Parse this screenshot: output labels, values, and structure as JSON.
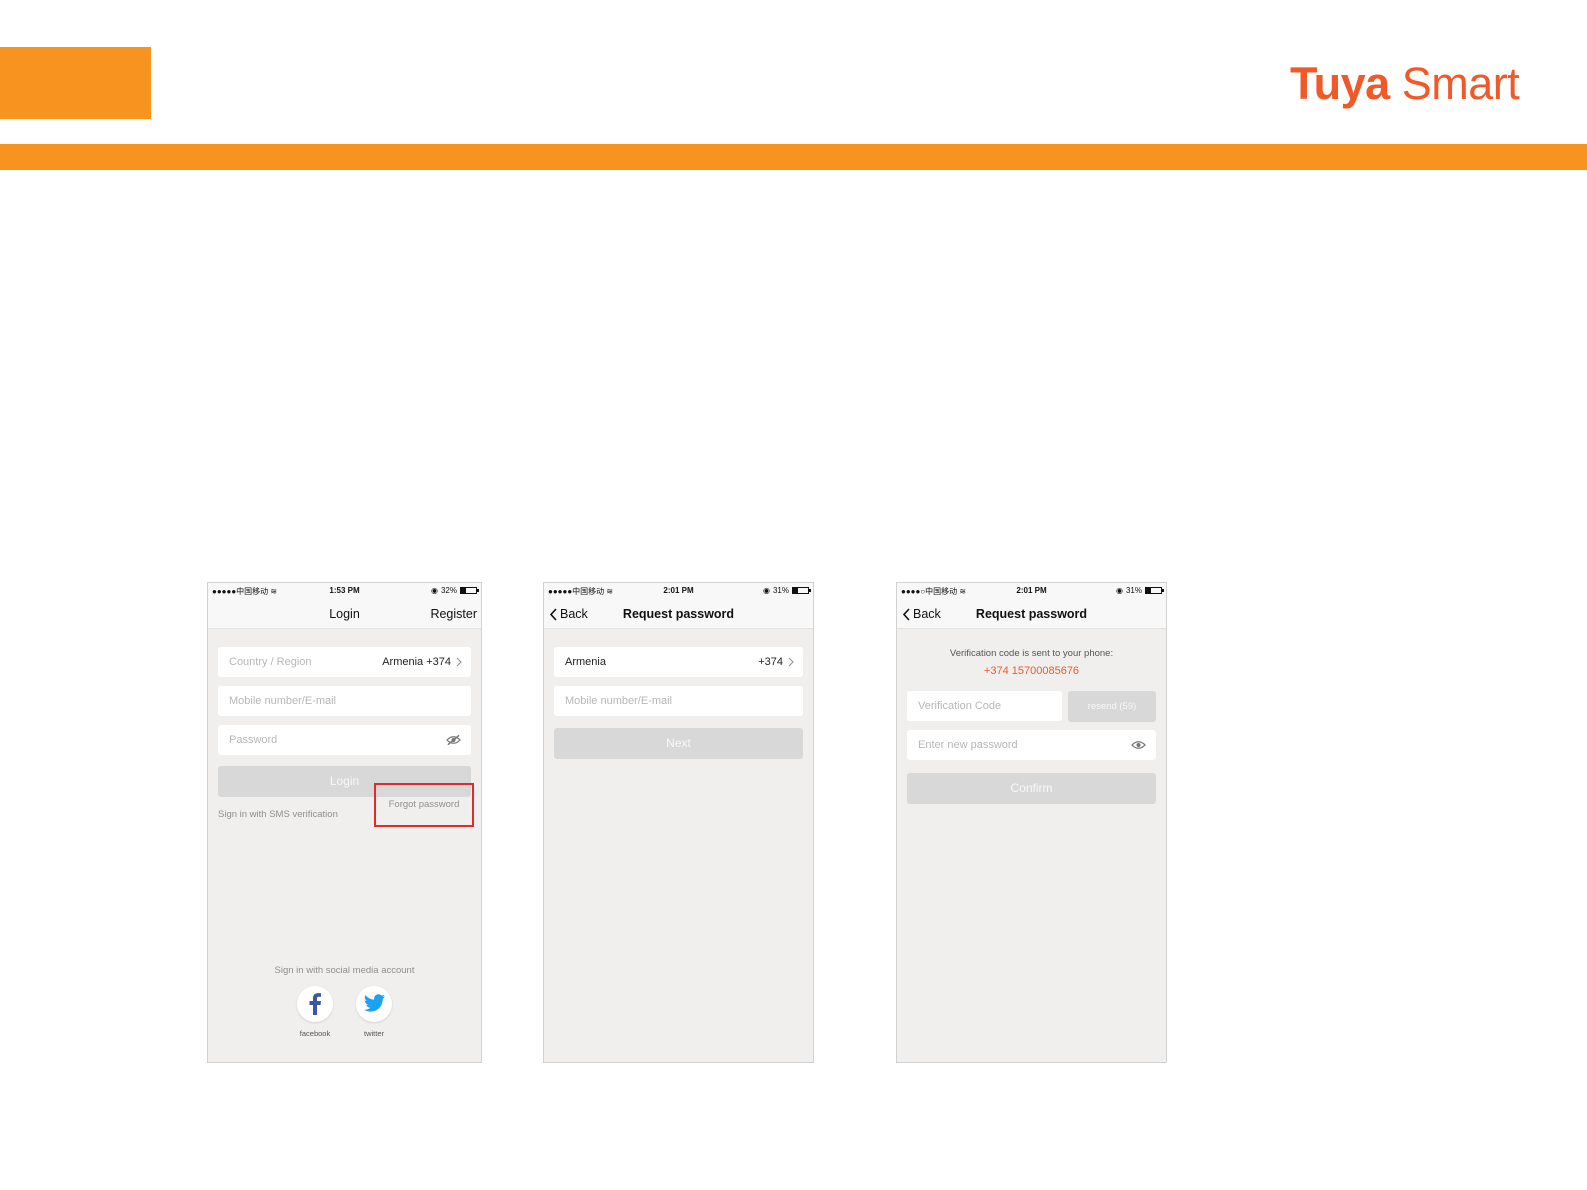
{
  "slide": {
    "logo": {
      "brand_part1": "Tuya",
      "brand_part2": " Smart"
    },
    "colors": {
      "accent_orange": "#f7931e",
      "logo_orange": "#f05a28",
      "highlight_red": "#e02b2b"
    }
  },
  "screen_login": {
    "status": {
      "carrier": "●●●●●中国移动",
      "time": "1:53 PM",
      "battery": "32%",
      "battery_level": 0.32
    },
    "nav": {
      "title": "Login",
      "right": "Register"
    },
    "country_placeholder": "Country / Region",
    "country_value": "Armenia +374",
    "mobile_placeholder": "Mobile number/E-mail",
    "password_placeholder": "Password",
    "login_button": "Login",
    "sms_link": "Sign in with SMS verification",
    "forgot_link": "Forgot password",
    "social_title": "Sign in with social media account",
    "social": [
      {
        "label": "facebook",
        "icon": "facebook-icon"
      },
      {
        "label": "twitter",
        "icon": "twitter-icon"
      }
    ]
  },
  "screen_request": {
    "status": {
      "carrier": "●●●●●中国移动",
      "time": "2:01 PM",
      "battery": "31%",
      "battery_level": 0.31
    },
    "nav": {
      "back": "Back",
      "title": "Request password"
    },
    "country_name": "Armenia",
    "country_code": "+374",
    "mobile_placeholder": "Mobile number/E-mail",
    "next_button": "Next"
  },
  "screen_verify": {
    "status": {
      "carrier": "●●●●○中国移动",
      "time": "2:01 PM",
      "battery": "31%",
      "battery_level": 0.31
    },
    "nav": {
      "back": "Back",
      "title": "Request password"
    },
    "message": "Verification code is sent to your phone:",
    "phone": "+374 15700085676",
    "code_placeholder": "Verification Code",
    "resend_button": "resend (59)",
    "new_password_placeholder": "Enter new password",
    "confirm_button": "Confirm"
  }
}
